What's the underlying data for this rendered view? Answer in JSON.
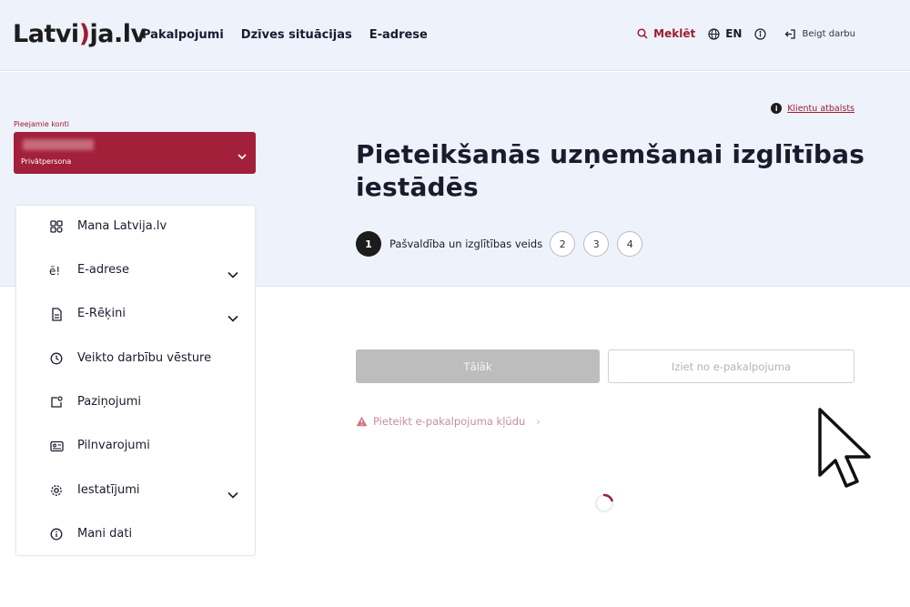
{
  "header": {
    "logo_text_a": "Latvi",
    "logo_text_b": "ja.lv",
    "nav": [
      "Pakalpojumi",
      "Dzīves situācijas",
      "E-adrese"
    ],
    "search_label": "Meklēt",
    "lang_label": "EN",
    "logout_label": "Beigt darbu"
  },
  "account": {
    "label": "Pieejamie konti",
    "type": "Privātpersona"
  },
  "sidebar": {
    "items": [
      {
        "label": "Mana Latvija.lv",
        "icon": "dashboard-grid-icon",
        "expandable": false
      },
      {
        "label": "E-adrese",
        "icon": "e-address-icon",
        "expandable": true
      },
      {
        "label": "E-Rēķini",
        "icon": "invoice-document-icon",
        "expandable": true
      },
      {
        "label": "Veikto darbību vēsture",
        "icon": "clock-history-icon",
        "expandable": false
      },
      {
        "label": "Paziņojumi",
        "icon": "notification-icon",
        "expandable": false
      },
      {
        "label": "Pilnvarojumi",
        "icon": "id-card-icon",
        "expandable": false
      },
      {
        "label": "Iestatījumi",
        "icon": "gear-icon",
        "expandable": true
      },
      {
        "label": "Mani dati",
        "icon": "info-circle-icon",
        "expandable": false
      }
    ]
  },
  "main": {
    "support_label": "Klientu atbalsts",
    "title": "Pieteikšanās uzņemšanai izglītības iestādēs",
    "stepper": {
      "current_number": "1",
      "current_label": "Pašvaldība un izglītības veids",
      "steps": [
        "2",
        "3",
        "4"
      ]
    },
    "next_button": "Tālāk",
    "exit_button": "Iziet no e-pakalpojuma",
    "report_link": "Pieteikt e-pakalpojuma kļūdu",
    "report_arrow": "›"
  },
  "colors": {
    "brand": "#9e1b32",
    "account_bg": "#a3203a",
    "header_bg": "#eef2fa",
    "disabled_button": "#bdbdbd"
  }
}
